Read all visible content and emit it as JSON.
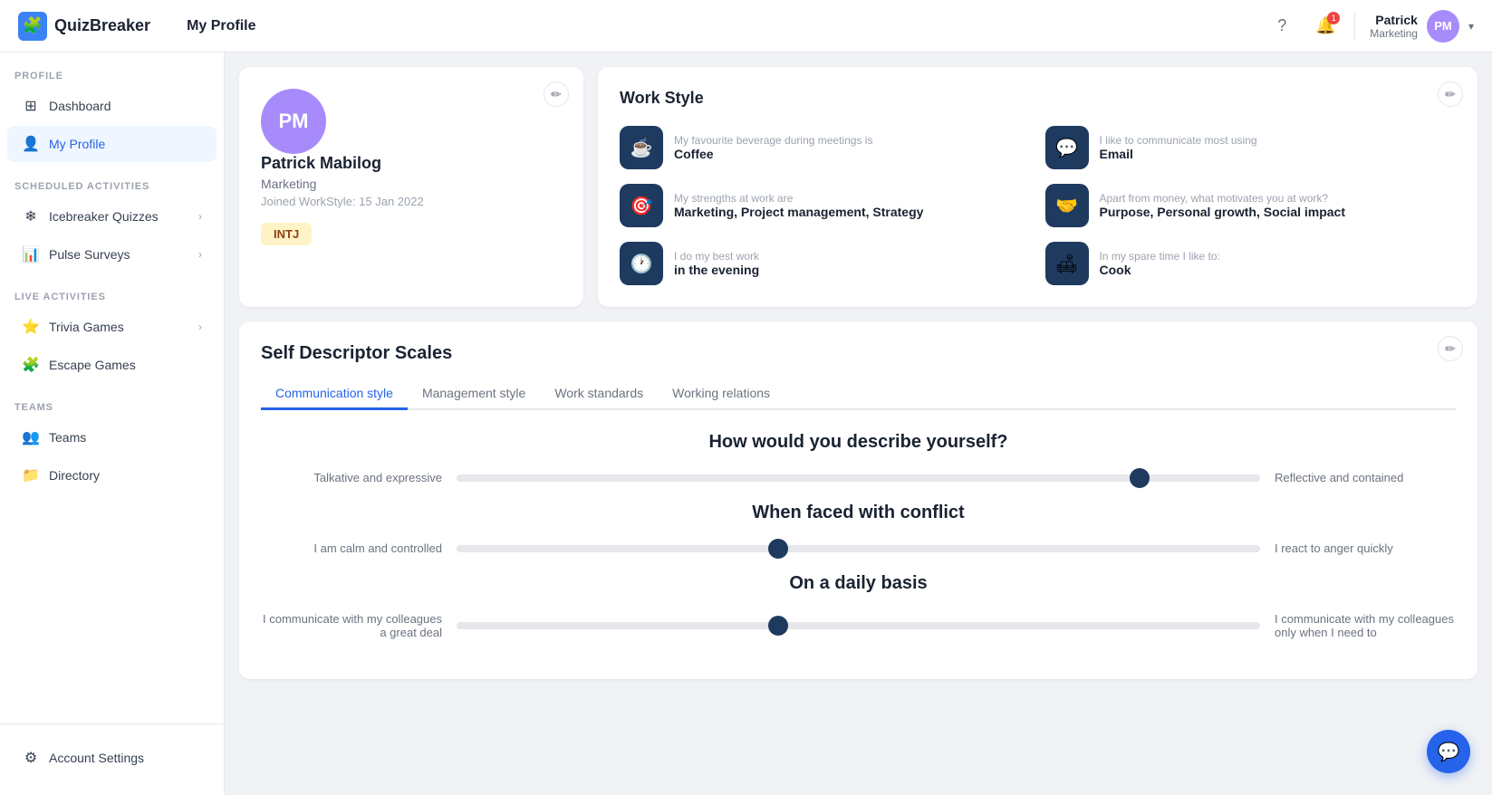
{
  "app": {
    "logo_text": "QuizBreaker",
    "page_title": "My Profile"
  },
  "topnav": {
    "user_name": "Patrick",
    "user_dept": "Marketing",
    "bell_count": "1",
    "chevron": "▾"
  },
  "sidebar": {
    "section_profile": "PROFILE",
    "item_dashboard": "Dashboard",
    "section_scheduled": "SCHEDULED ACTIVITIES",
    "item_icebreaker": "Icebreaker Quizzes",
    "item_pulse": "Pulse Surveys",
    "section_live": "LIVE ACTIVITIES",
    "item_trivia": "Trivia Games",
    "item_escape": "Escape Games",
    "section_teams": "TEAMS",
    "item_teams": "Teams",
    "item_directory": "Directory",
    "item_account": "Account Settings"
  },
  "profile": {
    "name": "Patrick Mabilog",
    "department": "Marketing",
    "joined": "Joined WorkStyle: 15 Jan 2022",
    "mbti": "INTJ",
    "initials": "PM"
  },
  "workstyle": {
    "title": "Work Style",
    "items": [
      {
        "label": "My favourite beverage during meetings is",
        "value": "Coffee",
        "icon": "☕"
      },
      {
        "label": "I like to communicate most using",
        "value": "Email",
        "icon": "💬"
      },
      {
        "label": "My strengths at work are",
        "value": "Marketing, Project management, Strategy",
        "icon": "🎯"
      },
      {
        "label": "Apart from money, what motivates you at work?",
        "value": "Purpose, Personal growth, Social impact",
        "icon": "🤝"
      },
      {
        "label": "I do my best work",
        "value": "in the evening",
        "icon": "🕐"
      },
      {
        "label": "In my spare time I like to:",
        "value": "Cook",
        "icon": "🛋"
      }
    ]
  },
  "descriptor": {
    "title": "Self Descriptor Scales",
    "tabs": [
      "Communication style",
      "Management style",
      "Work standards",
      "Working relations"
    ],
    "active_tab": "Communication style",
    "sections": [
      {
        "title": "How would you describe yourself?",
        "scales": [
          {
            "left": "Talkative and expressive",
            "right": "Reflective and contained",
            "position": 85
          }
        ]
      },
      {
        "title": "When faced with conflict",
        "scales": [
          {
            "left": "I am calm and controlled",
            "right": "I react to anger quickly",
            "position": 40
          }
        ]
      },
      {
        "title": "On a daily basis",
        "scales": [
          {
            "left": "I communicate with my colleagues a great deal",
            "right": "I communicate with my colleagues only when I need to",
            "position": 40
          }
        ]
      }
    ]
  },
  "chat_btn_icon": "💬"
}
